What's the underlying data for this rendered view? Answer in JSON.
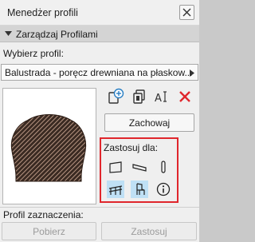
{
  "window": {
    "title": "Menedżer profili"
  },
  "section": {
    "title": "Zarządzaj Profilami"
  },
  "select": {
    "label": "Wybierz profil:",
    "value": "Balustrada - poręcz drewniana na płaskow..."
  },
  "actions": {
    "save_label": "Zachowaj"
  },
  "apply": {
    "label": "Zastosuj dla:"
  },
  "selection": {
    "label": "Profil zaznaczenia:",
    "get_label": "Pobierz",
    "apply_label": "Zastosuj"
  },
  "colors": {
    "highlight": "#e0262c",
    "accent": "#2a7fc4",
    "active_bg": "#bfe0f5"
  }
}
